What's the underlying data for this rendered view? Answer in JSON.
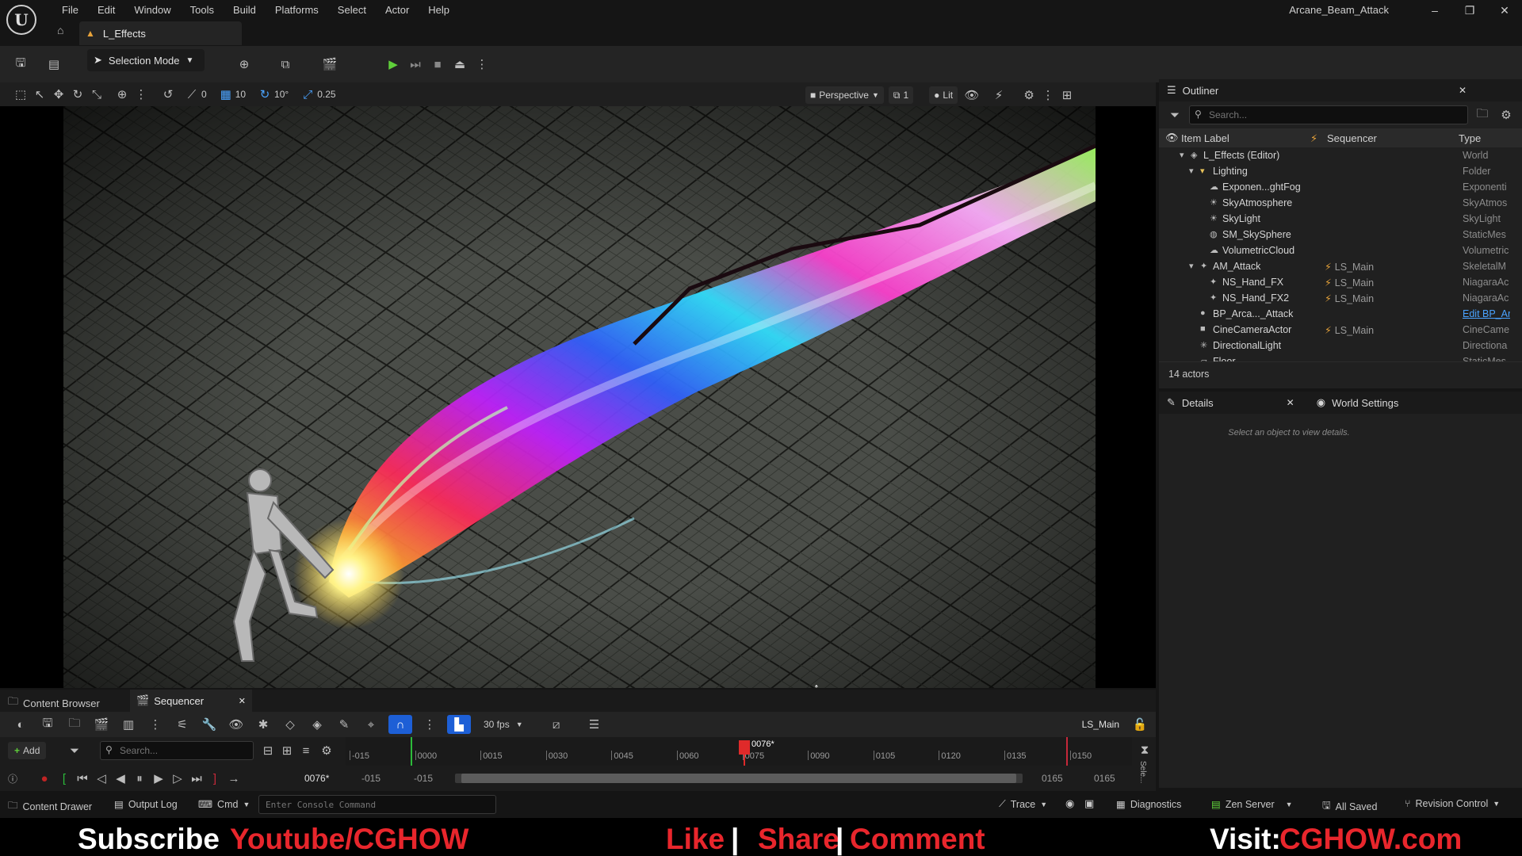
{
  "app": {
    "logo": "U",
    "menu": [
      "File",
      "Edit",
      "Window",
      "Tools",
      "Build",
      "Platforms",
      "Select",
      "Actor",
      "Help"
    ],
    "window_title": "Arcane_Beam_Attack",
    "level_tab": "L_Effects",
    "window_controls": [
      "–",
      "❐",
      "✕"
    ]
  },
  "toolbar": {
    "selection_mode": "Selection Mode"
  },
  "viewport_toolbar": {
    "rot_snap": "0",
    "grid_snap": "10",
    "angle_snap": "10°",
    "scale_snap": "0.25",
    "view_mode_perspective": "Perspective",
    "camera_speed": "1",
    "lit": "Lit"
  },
  "outliner": {
    "tab_label": "Outliner",
    "search_placeholder": "Search...",
    "columns": [
      "Item Label",
      "Sequencer",
      "Type"
    ],
    "rows": [
      {
        "label": "L_Effects (Editor)",
        "seq": "",
        "type": "World",
        "indent": 0
      },
      {
        "label": "Lighting",
        "seq": "",
        "type": "Folder",
        "indent": 1
      },
      {
        "label": "Exponen...ghtFog",
        "seq": "",
        "type": "Exponenti",
        "indent": 2
      },
      {
        "label": "SkyAtmosphere",
        "seq": "",
        "type": "SkyAtmos",
        "indent": 2
      },
      {
        "label": "SkyLight",
        "seq": "",
        "type": "SkyLight",
        "indent": 2
      },
      {
        "label": "SM_SkySphere",
        "seq": "",
        "type": "StaticMes",
        "indent": 2
      },
      {
        "label": "VolumetricCloud",
        "seq": "",
        "type": "Volumetric",
        "indent": 2
      },
      {
        "label": "AM_Attack",
        "seq": "LS_Main",
        "type": "SkeletalM",
        "indent": 1
      },
      {
        "label": "NS_Hand_FX",
        "seq": "LS_Main",
        "type": "NiagaraAc",
        "indent": 2
      },
      {
        "label": "NS_Hand_FX2",
        "seq": "LS_Main",
        "type": "NiagaraAc",
        "indent": 2
      },
      {
        "label": "BP_Arca..._Attack",
        "seq": "",
        "type": "Edit BP_Ar",
        "indent": 1
      },
      {
        "label": "CineCameraActor",
        "seq": "LS_Main",
        "type": "CineCame",
        "indent": 1
      },
      {
        "label": "DirectionalLight",
        "seq": "",
        "type": "Directiona",
        "indent": 1
      },
      {
        "label": "Floor",
        "seq": "",
        "type": "StaticMes",
        "indent": 1
      }
    ],
    "actor_count": "14 actors"
  },
  "details": {
    "tab_label": "Details",
    "world_settings_label": "World Settings",
    "empty_message": "Select an object to view details."
  },
  "bottom_tabs": {
    "content_browser": "Content Browser",
    "sequencer": "Sequencer"
  },
  "sequencer": {
    "fps": "30 fps",
    "sequence_name": "LS_Main",
    "add_label": "Add",
    "search_placeholder": "Search...",
    "current_frame": "0076*",
    "playhead_label": "0076*",
    "range_start_a": "-015",
    "range_start_b": "-015",
    "range_end_a": "0165",
    "range_end_b": "0165",
    "side_label": "Sele...",
    "ticks": [
      "-015",
      "0000",
      "0015",
      "0030",
      "0045",
      "0060",
      "0075",
      "0090",
      "0105",
      "0120",
      "0135",
      "0150"
    ]
  },
  "statusbar": {
    "content_drawer": "Content Drawer",
    "output_log": "Output Log",
    "cmd": "Cmd",
    "console_placeholder": "Enter Console Command",
    "trace": "Trace",
    "diagnostics": "Diagnostics",
    "zen_server": "Zen Server",
    "all_saved": "All Saved",
    "revision_control": "Revision Control"
  },
  "banner": {
    "subscribe": "Subscribe",
    "youtube": "Youtube/CGHOW",
    "like": "Like",
    "sep1": "|",
    "share": "Share",
    "sep2": "|",
    "comment": "Comment",
    "visit": "Visit:",
    "site": "CGHOW.com",
    "colors": {
      "white": "#ffffff",
      "red": "#e8262c"
    }
  }
}
